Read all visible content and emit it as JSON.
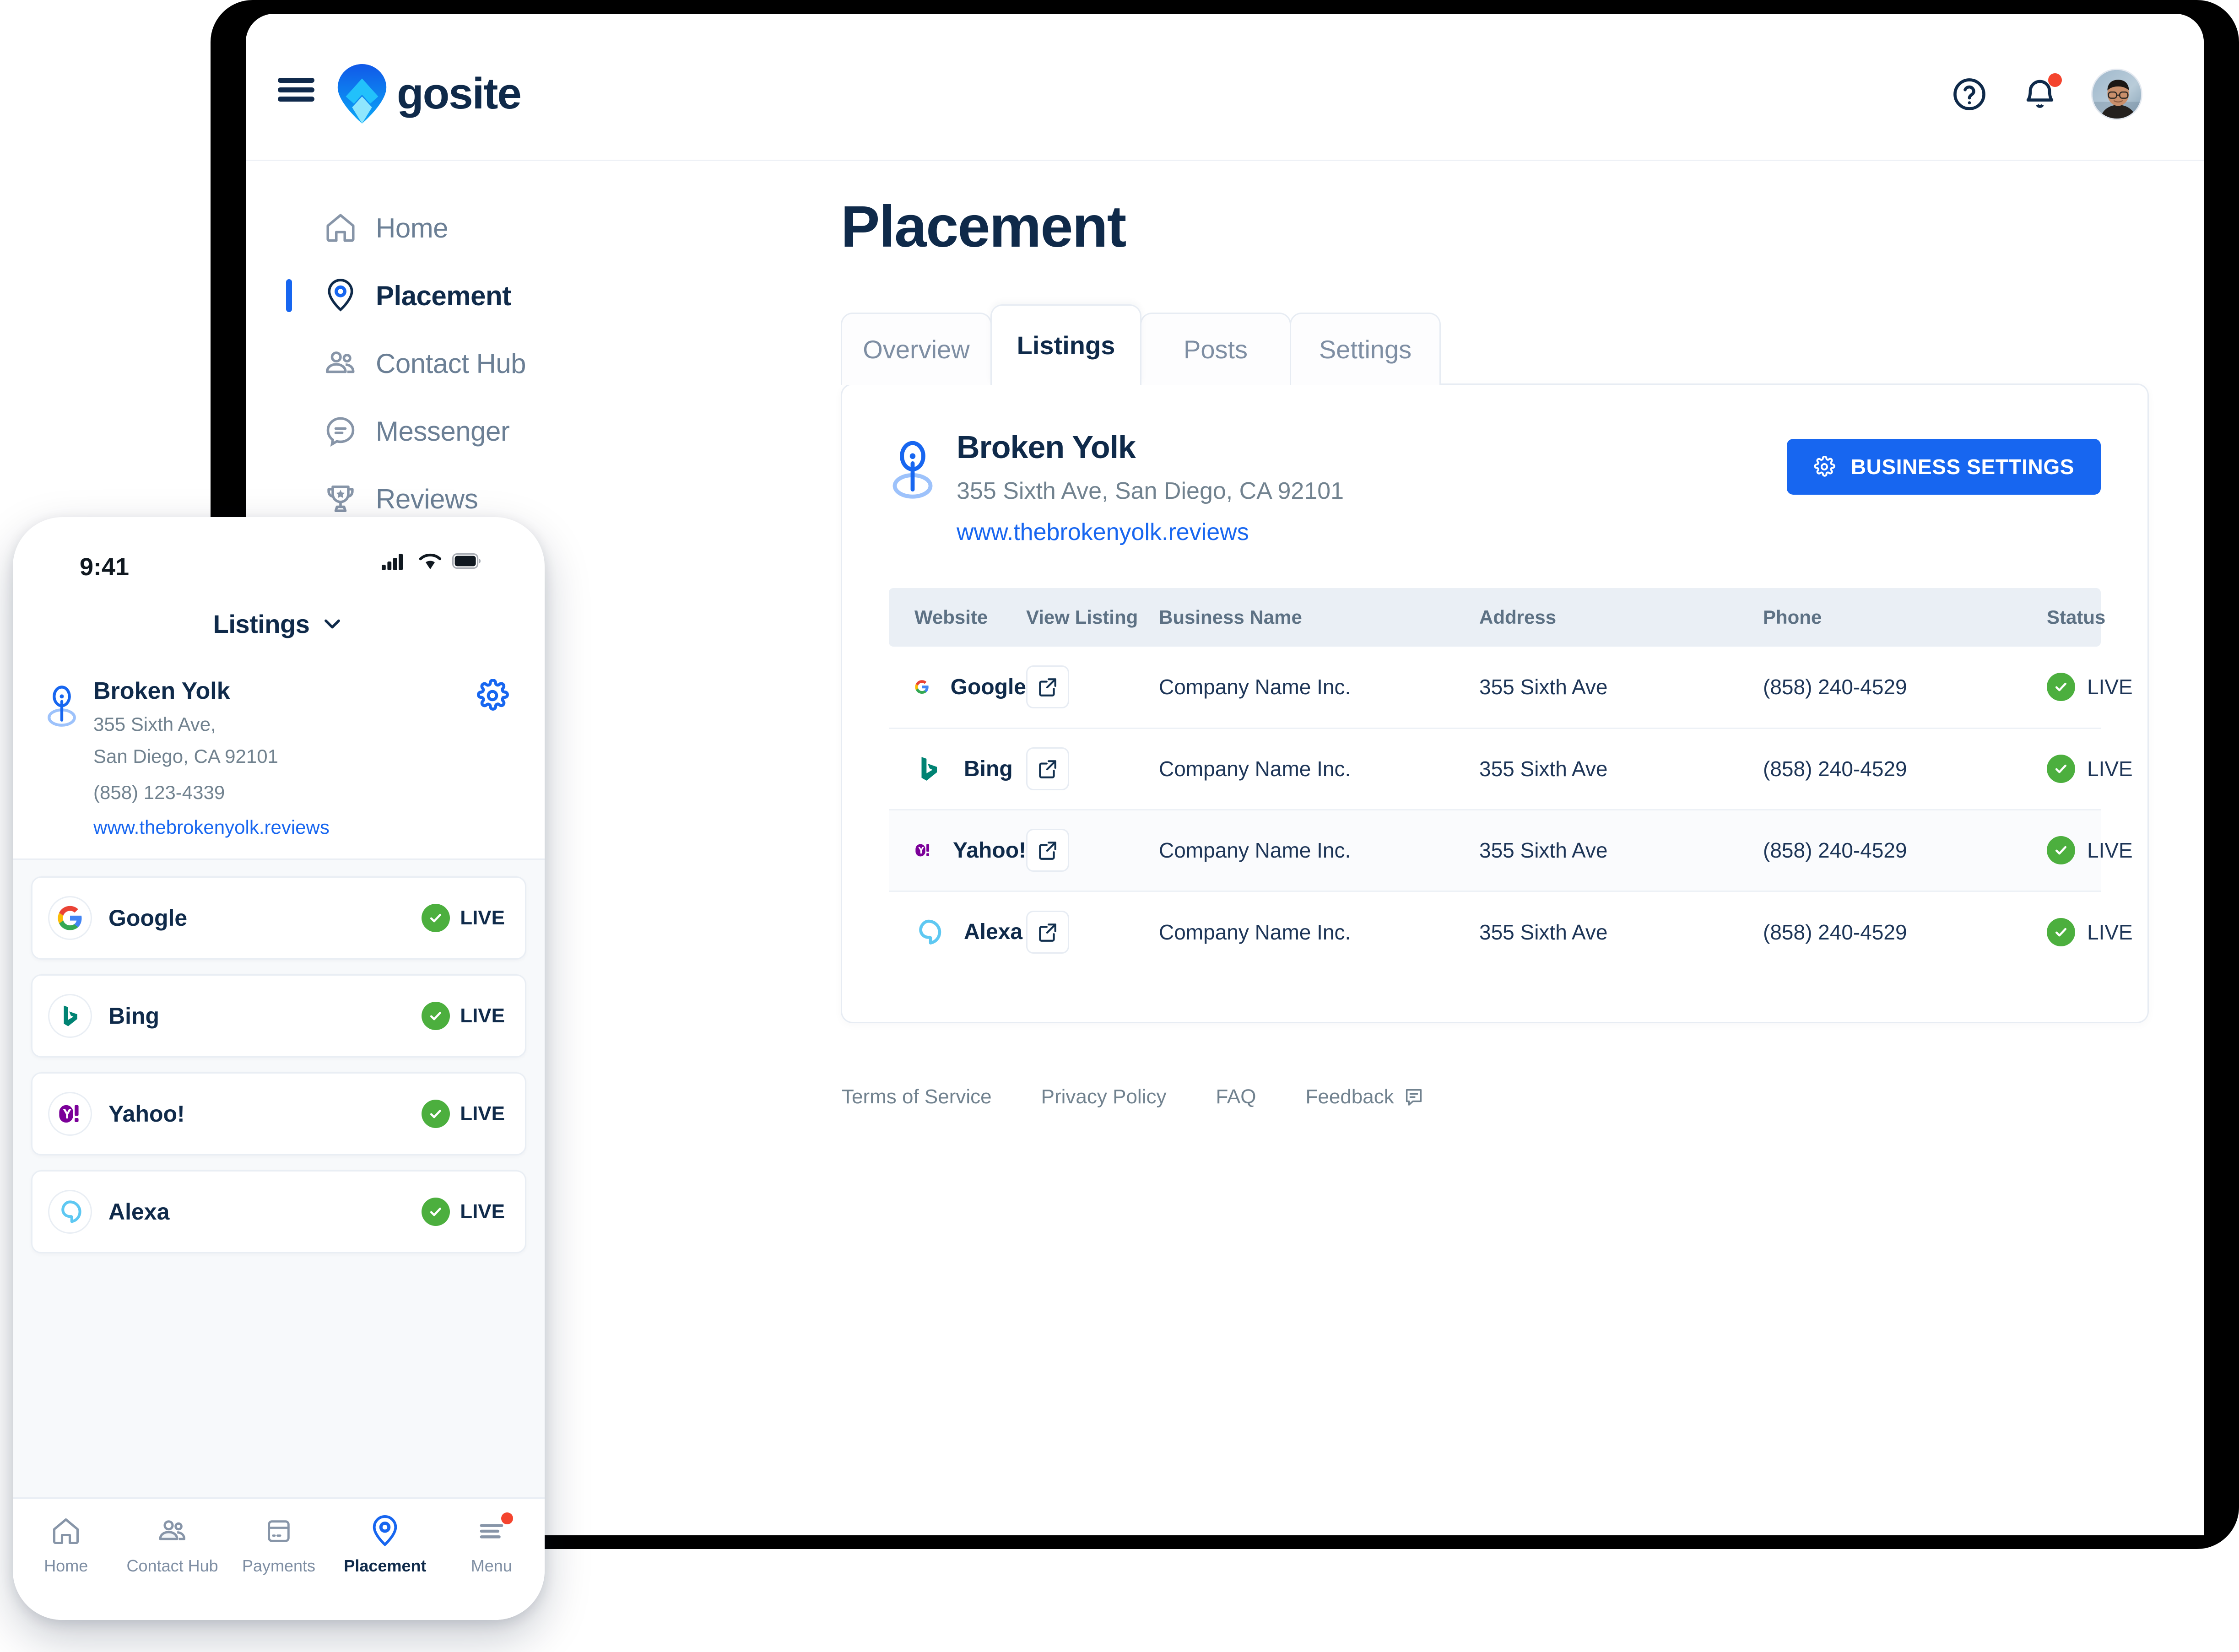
{
  "brand": {
    "name": "gosite",
    "logo_icon": "gosite-pin-logo"
  },
  "topbar": {
    "menu_icon": "hamburger-menu-icon",
    "help_icon": "help-circle-icon",
    "notifications_icon": "bell-icon",
    "avatar_icon": "user-avatar",
    "notification_badge": true
  },
  "sidebar": {
    "items": [
      {
        "label": "Home",
        "icon": "home-icon",
        "active": false
      },
      {
        "label": "Placement",
        "icon": "map-pin-icon",
        "active": true
      },
      {
        "label": "Contact Hub",
        "icon": "people-icon",
        "active": false
      },
      {
        "label": "Messenger",
        "icon": "chat-bubble-icon",
        "active": false
      },
      {
        "label": "Reviews",
        "icon": "trophy-icon",
        "active": false
      }
    ]
  },
  "main": {
    "page_title": "Placement",
    "tabs": [
      {
        "label": "Overview",
        "active": false
      },
      {
        "label": "Listings",
        "active": true
      },
      {
        "label": "Posts",
        "active": false
      },
      {
        "label": "Settings",
        "active": false
      }
    ],
    "business": {
      "pin_icon": "location-pin-icon",
      "name": "Broken Yolk",
      "address": "355 Sixth Ave, San Diego, CA 92101",
      "website": "www.thebrokenyolk.reviews"
    },
    "settings_button": {
      "label": "BUSINESS SETTINGS",
      "icon": "gear-icon",
      "color": "#1766f0"
    },
    "table": {
      "columns": [
        "Website",
        "View Listing",
        "Business Name",
        "Address",
        "Phone",
        "Status"
      ],
      "view_listing_icon": "external-link-icon",
      "rows": [
        {
          "website": "Google",
          "logo": "google-logo",
          "business_name": "Company Name Inc.",
          "address": "355 Sixth Ave",
          "phone": "(858) 240-4529",
          "status": "LIVE",
          "status_icon": "check-circle-icon",
          "highlight": false
        },
        {
          "website": "Bing",
          "logo": "bing-logo",
          "business_name": "Company Name Inc.",
          "address": "355 Sixth Ave",
          "phone": "(858) 240-4529",
          "status": "LIVE",
          "status_icon": "check-circle-icon",
          "highlight": false
        },
        {
          "website": "Yahoo!",
          "logo": "yahoo-logo",
          "business_name": "Company Name Inc.",
          "address": "355 Sixth Ave",
          "phone": "(858) 240-4529",
          "status": "LIVE",
          "status_icon": "check-circle-icon",
          "highlight": true
        },
        {
          "website": "Alexa",
          "logo": "alexa-logo",
          "business_name": "Company Name Inc.",
          "address": "355 Sixth Ave",
          "phone": "(858) 240-4529",
          "status": "LIVE",
          "status_icon": "check-circle-icon",
          "highlight": false
        }
      ]
    },
    "footer": {
      "links": [
        "Terms of Service",
        "Privacy Policy",
        "FAQ",
        "Feedback"
      ],
      "feedback_icon": "feedback-chat-icon"
    }
  },
  "phone": {
    "status_bar": {
      "time": "9:41",
      "signal_icon": "cellular-signal-icon",
      "wifi_icon": "wifi-icon",
      "battery_icon": "battery-icon"
    },
    "header": {
      "title": "Listings",
      "chevron_icon": "chevron-down-icon"
    },
    "business": {
      "pin_icon": "location-pin-icon",
      "name": "Broken Yolk",
      "address_line1": "355 Sixth Ave,",
      "address_line2": "San Diego, CA 92101",
      "phone": "(858) 123-4339",
      "website": "www.thebrokenyolk.reviews",
      "settings_icon": "gear-icon"
    },
    "listings": [
      {
        "name": "Google",
        "logo": "google-logo",
        "status": "LIVE",
        "status_icon": "check-circle-icon"
      },
      {
        "name": "Bing",
        "logo": "bing-logo",
        "status": "LIVE",
        "status_icon": "check-circle-icon"
      },
      {
        "name": "Yahoo!",
        "logo": "yahoo-logo",
        "status": "LIVE",
        "status_icon": "check-circle-icon"
      },
      {
        "name": "Alexa",
        "logo": "alexa-logo",
        "status": "LIVE",
        "status_icon": "check-circle-icon"
      }
    ],
    "bottom_nav": [
      {
        "label": "Home",
        "icon": "home-icon",
        "active": false,
        "badge": false
      },
      {
        "label": "Contact Hub",
        "icon": "people-icon",
        "active": false,
        "badge": false
      },
      {
        "label": "Payments",
        "icon": "credit-card-icon",
        "active": false,
        "badge": false
      },
      {
        "label": "Placement",
        "icon": "map-pin-icon",
        "active": true,
        "badge": false
      },
      {
        "label": "Menu",
        "icon": "hamburger-menu-icon",
        "active": false,
        "badge": true
      }
    ]
  },
  "colors": {
    "accent_blue": "#1766f0",
    "navy": "#0f2a4a",
    "status_green": "#4caf3e",
    "badge_red": "#f4442e"
  }
}
